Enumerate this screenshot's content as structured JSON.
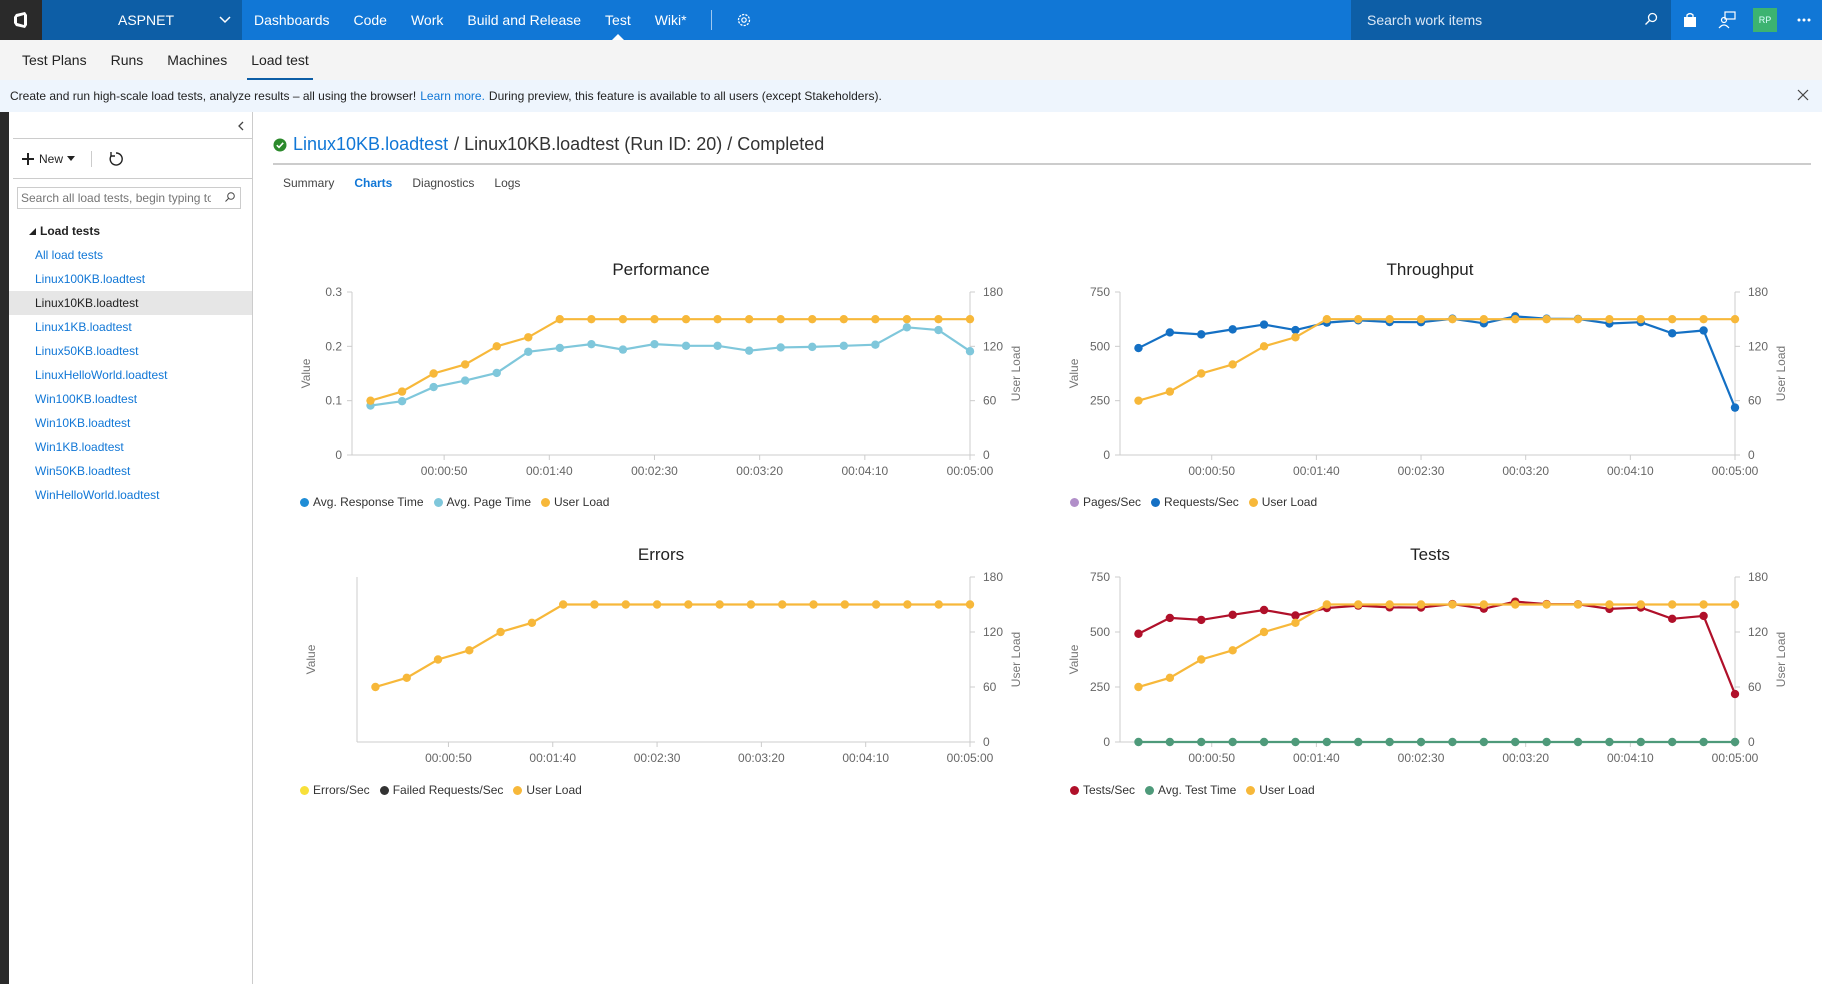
{
  "topbar": {
    "project": "ASPNET",
    "nav": [
      "Dashboards",
      "Code",
      "Work",
      "Build and Release",
      "Test",
      "Wiki*"
    ],
    "active_nav": "Test",
    "search_placeholder": "Search work items",
    "avatar_initials": "RP",
    "brand_color": "#1177d6"
  },
  "subnav": {
    "items": [
      "Test Plans",
      "Runs",
      "Machines",
      "Load test"
    ],
    "active": "Load test"
  },
  "banner": {
    "text_before": "Create and run high-scale load tests, analyze results – all using the browser!",
    "link": "Learn more.",
    "text_after": "During preview, this feature is available to all users (except Stakeholders)."
  },
  "sidebar": {
    "new_label": "New",
    "search_placeholder": "Search all load tests, begin typing to...",
    "tree_header": "Load tests",
    "items": [
      "All load tests",
      "Linux100KB.loadtest",
      "Linux10KB.loadtest",
      "Linux1KB.loadtest",
      "Linux50KB.loadtest",
      "LinuxHelloWorld.loadtest",
      "Win100KB.loadtest",
      "Win10KB.loadtest",
      "Win1KB.loadtest",
      "Win50KB.loadtest",
      "WinHelloWorld.loadtest"
    ],
    "selected": "Linux10KB.loadtest"
  },
  "main": {
    "breadcrumb_link": "Linux10KB.loadtest",
    "breadcrumb_run": "/ Linux10KB.loadtest (Run ID: 20) / Completed",
    "status": "completed",
    "tabs": [
      "Summary",
      "Charts",
      "Diagnostics",
      "Logs"
    ],
    "active_tab": "Charts"
  },
  "chart_data": [
    {
      "type": "line",
      "title": "Performance",
      "xlabel": "",
      "ylabel": "Value",
      "y2label": "User Load",
      "x": [
        "00:00:15",
        "00:00:30",
        "00:00:45",
        "00:01:00",
        "00:01:15",
        "00:01:30",
        "00:01:45",
        "00:02:00",
        "00:02:15",
        "00:02:30",
        "00:02:45",
        "00:03:00",
        "00:03:15",
        "00:03:30",
        "00:03:45",
        "00:04:00",
        "00:04:15",
        "00:04:30",
        "00:04:45",
        "00:05:00"
      ],
      "x_seconds": [
        15,
        30,
        45,
        60,
        75,
        90,
        105,
        120,
        135,
        150,
        165,
        180,
        195,
        210,
        225,
        240,
        255,
        270,
        285,
        300
      ],
      "xticks": [
        "00:00:50",
        "00:01:40",
        "00:02:30",
        "00:03:20",
        "00:04:10",
        "00:05:00"
      ],
      "xtick_seconds": [
        50,
        100,
        150,
        200,
        250,
        300
      ],
      "xlim": [
        10,
        300
      ],
      "ylim": [
        0,
        0.3
      ],
      "yticks": [
        0,
        0.1,
        0.2,
        0.3
      ],
      "y2lim": [
        0,
        180
      ],
      "y2ticks": [
        0,
        60,
        120,
        180
      ],
      "grid": false,
      "legend_position": "bottom-left",
      "series": [
        {
          "name": "Avg. Response Time",
          "color": "#1f8dd6",
          "axis": "left",
          "values": []
        },
        {
          "name": "Avg. Page Time",
          "color": "#7fc7db",
          "axis": "left",
          "values": [
            0.091,
            0.099,
            0.125,
            0.137,
            0.151,
            0.19,
            0.197,
            0.204,
            0.194,
            0.204,
            0.201,
            0.201,
            0.192,
            0.198,
            0.199,
            0.201,
            0.203,
            0.235,
            0.23,
            0.191
          ]
        },
        {
          "name": "User Load",
          "color": "#f7b83a",
          "axis": "right",
          "values": [
            60,
            70,
            90,
            100,
            120,
            130,
            150,
            150,
            150,
            150,
            150,
            150,
            150,
            150,
            150,
            150,
            150,
            150,
            150,
            150
          ]
        }
      ]
    },
    {
      "type": "line",
      "title": "Throughput",
      "xlabel": "",
      "ylabel": "Value",
      "y2label": "User Load",
      "x_seconds": [
        15,
        30,
        45,
        60,
        75,
        90,
        105,
        120,
        135,
        150,
        165,
        180,
        195,
        210,
        225,
        240,
        255,
        270,
        285,
        300
      ],
      "xticks": [
        "00:00:50",
        "00:01:40",
        "00:02:30",
        "00:03:20",
        "00:04:10",
        "00:05:00"
      ],
      "xtick_seconds": [
        50,
        100,
        150,
        200,
        250,
        300
      ],
      "xlim": [
        10,
        300
      ],
      "ylim": [
        0,
        750
      ],
      "yticks": [
        0,
        250,
        500,
        750
      ],
      "y2lim": [
        0,
        180
      ],
      "y2ticks": [
        0,
        60,
        120,
        180
      ],
      "grid": false,
      "legend_position": "bottom-left",
      "series": [
        {
          "name": "Pages/Sec",
          "color": "#b18fc9",
          "axis": "left",
          "values": []
        },
        {
          "name": "Requests/Sec",
          "color": "#1470c4",
          "axis": "left",
          "values": [
            492,
            564,
            555,
            578,
            600,
            575,
            609,
            620,
            612,
            611,
            627,
            606,
            638,
            627,
            626,
            605,
            611,
            560,
            573,
            218
          ]
        },
        {
          "name": "User Load",
          "color": "#f7b83a",
          "axis": "right",
          "values": [
            60,
            70,
            90,
            100,
            120,
            130,
            150,
            150,
            150,
            150,
            150,
            150,
            150,
            150,
            150,
            150,
            150,
            150,
            150,
            150
          ]
        }
      ]
    },
    {
      "type": "line",
      "title": "Errors",
      "xlabel": "",
      "ylabel": "Value",
      "y2label": "User Load",
      "x_seconds": [
        15,
        30,
        45,
        60,
        75,
        90,
        105,
        120,
        135,
        150,
        165,
        180,
        195,
        210,
        225,
        240,
        255,
        270,
        285,
        300
      ],
      "xticks": [
        "00:00:50",
        "00:01:40",
        "00:02:30",
        "00:03:20",
        "00:04:10",
        "00:05:00"
      ],
      "xtick_seconds": [
        50,
        100,
        150,
        200,
        250,
        300
      ],
      "xlim": [
        10,
        300
      ],
      "ylim": null,
      "yticks": [],
      "y2lim": [
        0,
        180
      ],
      "y2ticks": [
        0,
        60,
        120,
        180
      ],
      "grid": false,
      "legend_position": "bottom-left",
      "series": [
        {
          "name": "Errors/Sec",
          "color": "#f8e03a",
          "axis": "left",
          "values": []
        },
        {
          "name": "Failed Requests/Sec",
          "color": "#333333",
          "axis": "left",
          "values": []
        },
        {
          "name": "User Load",
          "color": "#f7b83a",
          "axis": "right",
          "values": [
            60,
            70,
            90,
            100,
            120,
            130,
            150,
            150,
            150,
            150,
            150,
            150,
            150,
            150,
            150,
            150,
            150,
            150,
            150,
            150
          ]
        }
      ]
    },
    {
      "type": "line",
      "title": "Tests",
      "xlabel": "",
      "ylabel": "Value",
      "y2label": "User Load",
      "x_seconds": [
        15,
        30,
        45,
        60,
        75,
        90,
        105,
        120,
        135,
        150,
        165,
        180,
        195,
        210,
        225,
        240,
        255,
        270,
        285,
        300
      ],
      "xticks": [
        "00:00:50",
        "00:01:40",
        "00:02:30",
        "00:03:20",
        "00:04:10",
        "00:05:00"
      ],
      "xtick_seconds": [
        50,
        100,
        150,
        200,
        250,
        300
      ],
      "xlim": [
        10,
        300
      ],
      "ylim": [
        0,
        750
      ],
      "yticks": [
        0,
        250,
        500,
        750
      ],
      "y2lim": [
        0,
        180
      ],
      "y2ticks": [
        0,
        60,
        120,
        180
      ],
      "grid": false,
      "legend_position": "bottom-left",
      "series": [
        {
          "name": "Tests/Sec",
          "color": "#b0102a",
          "axis": "left",
          "values": [
            492,
            564,
            555,
            578,
            600,
            575,
            609,
            620,
            612,
            611,
            627,
            606,
            638,
            627,
            626,
            605,
            611,
            560,
            573,
            218
          ]
        },
        {
          "name": "Avg. Test Time",
          "color": "#4e9a7a",
          "axis": "left",
          "values": [
            0,
            0,
            0,
            0,
            0,
            0,
            0,
            0,
            0,
            0,
            0,
            0,
            0,
            0,
            0,
            0,
            0,
            0,
            0,
            0
          ]
        },
        {
          "name": "User Load",
          "color": "#f7b83a",
          "axis": "right",
          "values": [
            60,
            70,
            90,
            100,
            120,
            130,
            150,
            150,
            150,
            150,
            150,
            150,
            150,
            150,
            150,
            150,
            150,
            150,
            150,
            150
          ]
        }
      ]
    }
  ]
}
